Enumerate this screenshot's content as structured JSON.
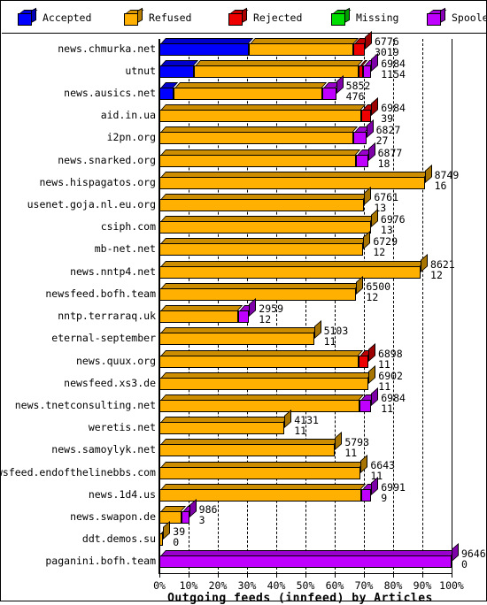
{
  "legend": {
    "items": [
      {
        "label": "Accepted",
        "color": "#0000ff",
        "icon": "cube-icon"
      },
      {
        "label": "Refused",
        "color": "#ffb000",
        "icon": "cube-icon"
      },
      {
        "label": "Rejected",
        "color": "#ee0000",
        "icon": "cube-icon"
      },
      {
        "label": "Missing",
        "color": "#00dd00",
        "icon": "cube-icon"
      },
      {
        "label": "Spooled",
        "color": "#bf00ff",
        "icon": "cube-icon"
      }
    ]
  },
  "chart_data": {
    "type": "bar",
    "orientation": "horizontal",
    "stacked": true,
    "percent_scale": true,
    "title": "Outgoing feeds (innfeed) by Articles",
    "xlabel": "",
    "ylabel": "",
    "xlim": [
      0,
      100
    ],
    "xticks": [
      "0%",
      "10%",
      "20%",
      "30%",
      "40%",
      "50%",
      "60%",
      "70%",
      "80%",
      "90%",
      "100%"
    ],
    "grid": true,
    "legend_position": "top",
    "series_names": [
      "Accepted",
      "Refused",
      "Rejected",
      "Missing",
      "Spooled"
    ],
    "series_colors": [
      "#0000ff",
      "#ffb000",
      "#ee0000",
      "#00dd00",
      "#bf00ff"
    ],
    "categories": [
      "news.chmurka.net",
      "utnut",
      "news.ausics.net",
      "aid.in.ua",
      "i2pn.org",
      "news.snarked.org",
      "news.hispagatos.org",
      "usenet.goja.nl.eu.org",
      "csiph.com",
      "mb-net.net",
      "news.nntp4.net",
      "newsfeed.bofh.team",
      "nntp.terraraq.uk",
      "eternal-september",
      "news.quux.org",
      "newsfeed.xs3.de",
      "news.tnetconsulting.net",
      "weretis.net",
      "news.samoylyk.net",
      "newsfeed.endofthelinebbs.com",
      "news.1d4.us",
      "news.swapon.de",
      "ddt.demos.su",
      "paganini.bofh.team"
    ],
    "rows": [
      {
        "category": "news.chmurka.net",
        "label_top": "6776",
        "label_bottom": "3019",
        "total_pct": 70.3,
        "segments": [
          {
            "name": "Accepted",
            "pct": 30.5
          },
          {
            "name": "Refused",
            "pct": 36.0
          },
          {
            "name": "Rejected",
            "pct": 3.8
          }
        ]
      },
      {
        "category": "utnut",
        "label_top": "6984",
        "label_bottom": "1154",
        "total_pct": 72.5,
        "segments": [
          {
            "name": "Accepted",
            "pct": 11.8
          },
          {
            "name": "Refused",
            "pct": 56.5
          },
          {
            "name": "Rejected",
            "pct": 1.4
          },
          {
            "name": "Spooled",
            "pct": 2.8
          }
        ]
      },
      {
        "category": "news.ausics.net",
        "label_top": "5852",
        "label_bottom": "476",
        "total_pct": 60.5,
        "segments": [
          {
            "name": "Accepted",
            "pct": 4.9
          },
          {
            "name": "Refused",
            "pct": 51.0
          },
          {
            "name": "Spooled",
            "pct": 4.6
          }
        ]
      },
      {
        "category": "aid.in.ua",
        "label_top": "6984",
        "label_bottom": "39",
        "total_pct": 72.5,
        "segments": [
          {
            "name": "Refused",
            "pct": 69.0
          },
          {
            "name": "Rejected",
            "pct": 3.5
          }
        ]
      },
      {
        "category": "i2pn.org",
        "label_top": "6827",
        "label_bottom": "27",
        "total_pct": 70.8,
        "segments": [
          {
            "name": "Refused",
            "pct": 66.5
          },
          {
            "name": "Spooled",
            "pct": 4.3
          }
        ]
      },
      {
        "category": "news.snarked.org",
        "label_top": "6877",
        "label_bottom": "18",
        "total_pct": 71.4,
        "segments": [
          {
            "name": "Refused",
            "pct": 67.2
          },
          {
            "name": "Spooled",
            "pct": 4.2
          }
        ]
      },
      {
        "category": "news.hispagatos.org",
        "label_top": "8749",
        "label_bottom": "16",
        "total_pct": 90.8,
        "segments": [
          {
            "name": "Refused",
            "pct": 90.8
          }
        ]
      },
      {
        "category": "usenet.goja.nl.eu.org",
        "label_top": "6761",
        "label_bottom": "13",
        "total_pct": 70.1,
        "segments": [
          {
            "name": "Refused",
            "pct": 70.1
          }
        ]
      },
      {
        "category": "csiph.com",
        "label_top": "6976",
        "label_bottom": "13",
        "total_pct": 72.4,
        "segments": [
          {
            "name": "Refused",
            "pct": 72.4
          }
        ]
      },
      {
        "category": "mb-net.net",
        "label_top": "6729",
        "label_bottom": "12",
        "total_pct": 69.8,
        "segments": [
          {
            "name": "Refused",
            "pct": 69.8
          }
        ]
      },
      {
        "category": "news.nntp4.net",
        "label_top": "8621",
        "label_bottom": "12",
        "total_pct": 89.4,
        "segments": [
          {
            "name": "Refused",
            "pct": 89.4
          }
        ]
      },
      {
        "category": "newsfeed.bofh.team",
        "label_top": "6500",
        "label_bottom": "12",
        "total_pct": 67.4,
        "segments": [
          {
            "name": "Refused",
            "pct": 67.4
          }
        ]
      },
      {
        "category": "nntp.terraraq.uk",
        "label_top": "2959",
        "label_bottom": "12",
        "total_pct": 30.7,
        "segments": [
          {
            "name": "Refused",
            "pct": 26.9
          },
          {
            "name": "Spooled",
            "pct": 3.8
          }
        ]
      },
      {
        "category": "eternal-september",
        "label_top": "5103",
        "label_bottom": "11",
        "total_pct": 52.9,
        "segments": [
          {
            "name": "Refused",
            "pct": 52.9
          }
        ]
      },
      {
        "category": "news.quux.org",
        "label_top": "6898",
        "label_bottom": "11",
        "total_pct": 71.5,
        "segments": [
          {
            "name": "Refused",
            "pct": 68.2
          },
          {
            "name": "Rejected",
            "pct": 3.3
          }
        ]
      },
      {
        "category": "newsfeed.xs3.de",
        "label_top": "6902",
        "label_bottom": "11",
        "total_pct": 71.6,
        "segments": [
          {
            "name": "Refused",
            "pct": 71.6
          }
        ]
      },
      {
        "category": "news.tnetconsulting.net",
        "label_top": "6984",
        "label_bottom": "11",
        "total_pct": 72.5,
        "segments": [
          {
            "name": "Refused",
            "pct": 68.4
          },
          {
            "name": "Spooled",
            "pct": 4.1
          }
        ]
      },
      {
        "category": "weretis.net",
        "label_top": "4131",
        "label_bottom": "11",
        "total_pct": 42.8,
        "segments": [
          {
            "name": "Refused",
            "pct": 42.8
          }
        ]
      },
      {
        "category": "news.samoylyk.net",
        "label_top": "5793",
        "label_bottom": "11",
        "total_pct": 60.1,
        "segments": [
          {
            "name": "Refused",
            "pct": 60.1
          }
        ]
      },
      {
        "category": "newsfeed.endofthelinebbs.com",
        "label_top": "6643",
        "label_bottom": "11",
        "total_pct": 68.9,
        "segments": [
          {
            "name": "Refused",
            "pct": 68.9
          }
        ]
      },
      {
        "category": "news.1d4.us",
        "label_top": "6991",
        "label_bottom": "9",
        "total_pct": 72.5,
        "segments": [
          {
            "name": "Refused",
            "pct": 69.0
          },
          {
            "name": "Spooled",
            "pct": 3.5
          }
        ]
      },
      {
        "category": "news.swapon.de",
        "label_top": "986",
        "label_bottom": "3",
        "total_pct": 10.2,
        "segments": [
          {
            "name": "Refused",
            "pct": 7.6
          },
          {
            "name": "Spooled",
            "pct": 2.6
          }
        ]
      },
      {
        "category": "ddt.demos.su",
        "label_top": "39",
        "label_bottom": "0",
        "total_pct": 1.3,
        "segments": [
          {
            "name": "Refused",
            "pct": 1.3
          }
        ]
      },
      {
        "category": "paganini.bofh.team",
        "label_top": "9646",
        "label_bottom": "0",
        "total_pct": 100.0,
        "segments": [
          {
            "name": "Spooled",
            "pct": 100.0
          }
        ]
      }
    ]
  }
}
